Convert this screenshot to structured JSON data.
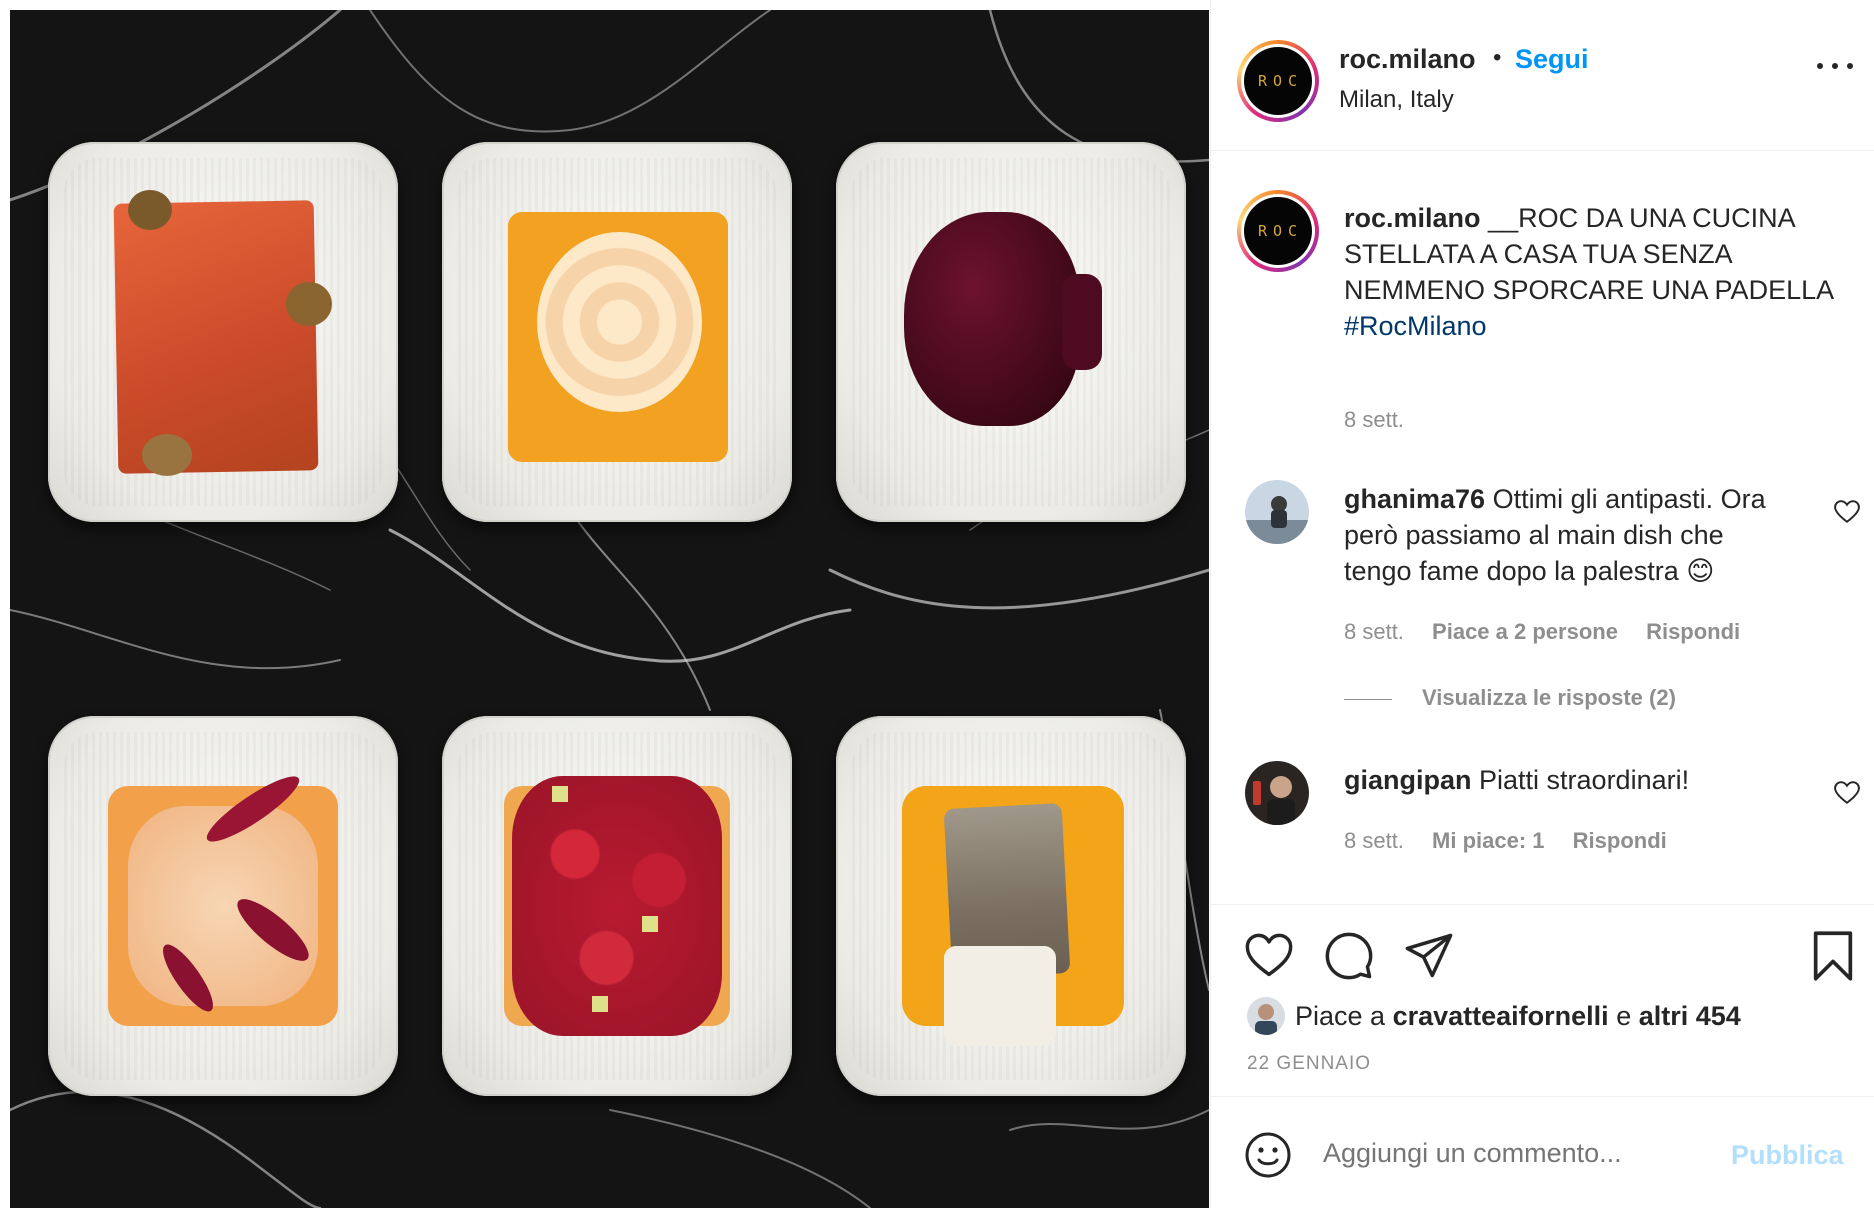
{
  "post": {
    "author": "roc.milano",
    "follow_label": "Segui",
    "separator": "•",
    "location": "Milan, Italy",
    "avatar_logo": "ROC",
    "image_description_icon": "food-photo",
    "more_icon": "more-options-icon"
  },
  "caption": {
    "username": "roc.milano",
    "text": "__ROC DA UNA CUCINA STELLATA A CASA TUA SENZA NEMMENO SPORCARE UNA PADELLA",
    "hashtag": "#RocMilano",
    "time": "8 sett."
  },
  "comments": [
    {
      "username": "ghanima76",
      "text": "Ottimi gli antipasti. Ora però passiamo al main dish che tengo fame dopo la palestra 😊",
      "time": "8 sett.",
      "likes": "Piace a 2 persone",
      "reply": "Rispondi",
      "view_replies": "Visualizza le risposte (2)"
    },
    {
      "username": "giangipan",
      "text": "Piatti straordinari!",
      "time": "8 sett.",
      "likes": "Mi piace: 1",
      "reply": "Rispondi"
    }
  ],
  "likes": {
    "prefix": "Piace a",
    "user": "cravatteaifornelli",
    "conjunction": "e",
    "others": "altri 454"
  },
  "date": "22 GENNAIO",
  "composer": {
    "placeholder": "Aggiungi un commento...",
    "publish": "Pubblica"
  },
  "colors": {
    "link": "#0095f6",
    "hashtag": "#00376b",
    "muted": "#8e8e8e",
    "publish_disabled": "#b2dffc"
  }
}
